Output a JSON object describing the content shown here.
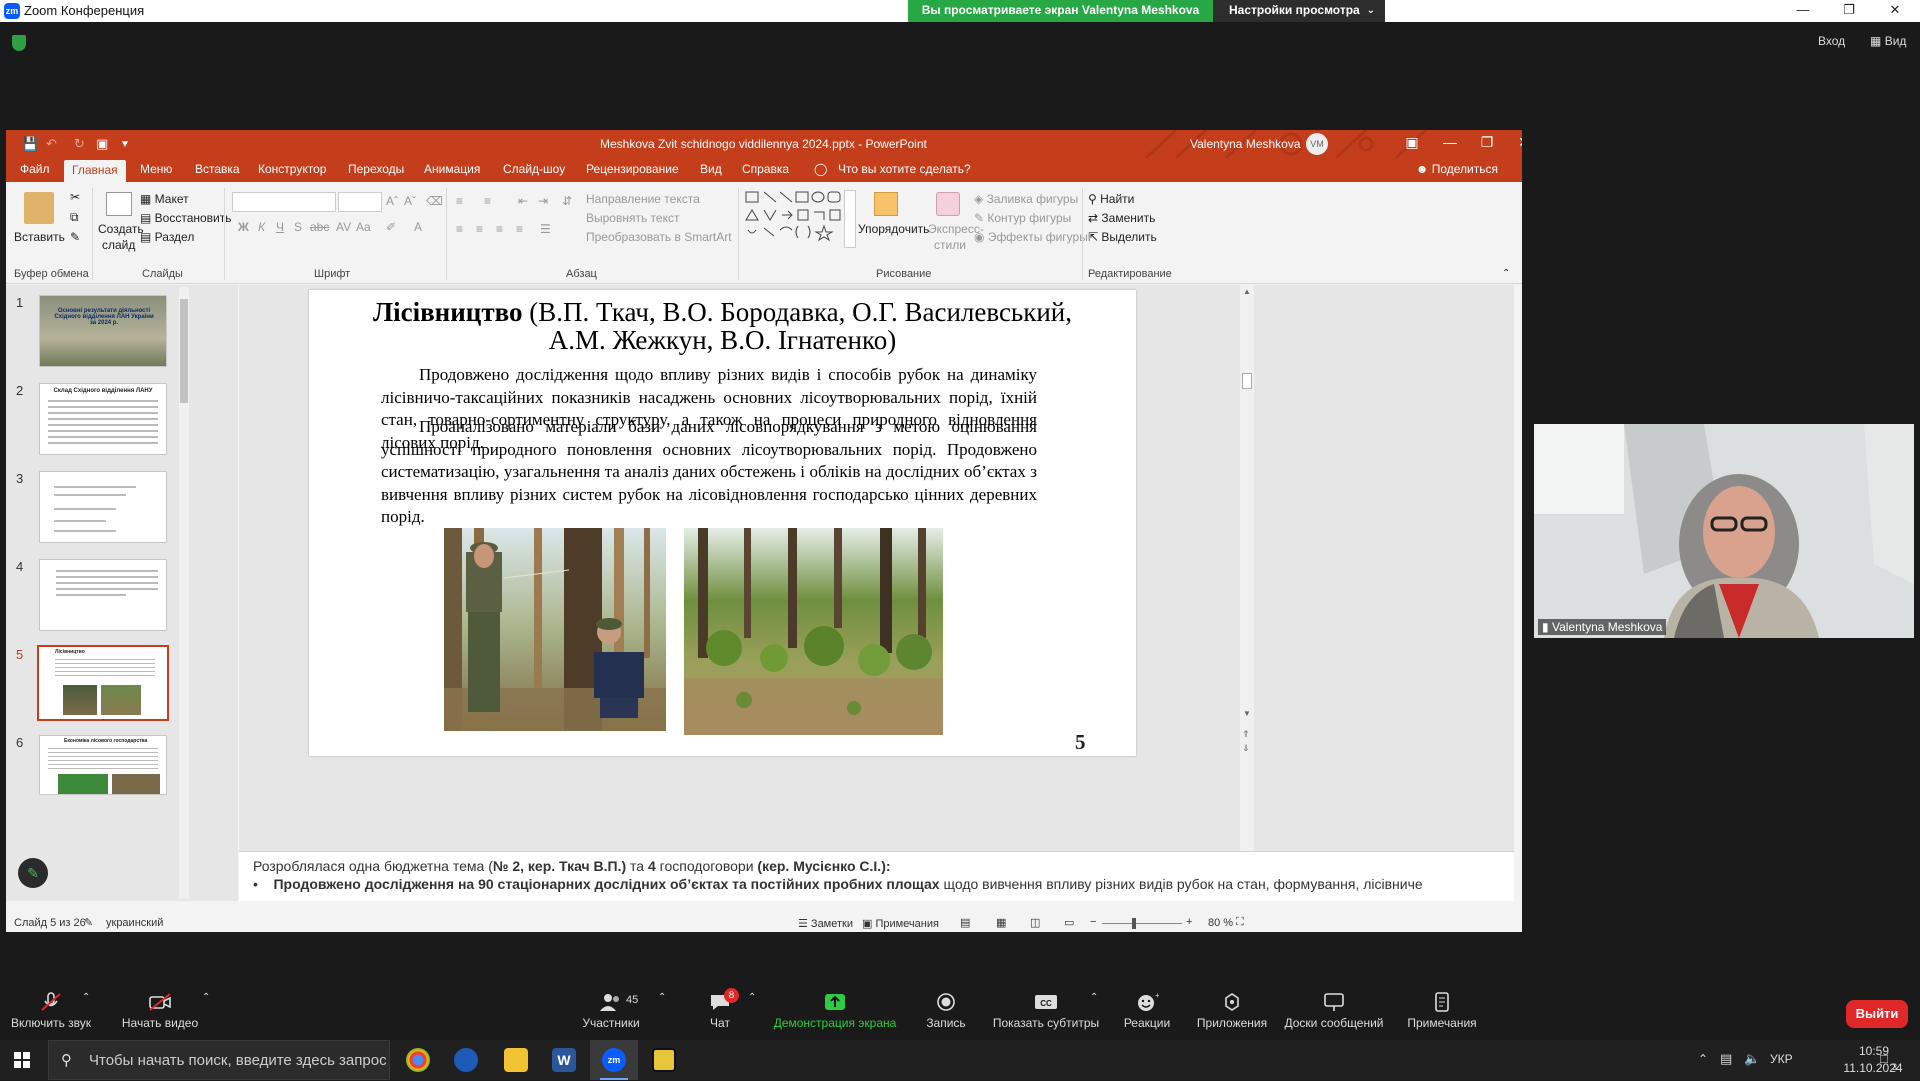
{
  "zoom": {
    "window_title": "Zoom Конференция",
    "viewing_banner": "Вы просматриваете экран Valentynа Meshkova",
    "view_options": "Настройки просмотра",
    "top_right": {
      "exit_fullscreen": "Вход",
      "view": "Вид"
    },
    "toolbar": {
      "unmute": "Включить звук",
      "start_video": "Начать видео",
      "participants": "Участники",
      "participants_count": "45",
      "chat": "Чат",
      "chat_badge": "8",
      "share_screen": "Демонстрация экрана",
      "record": "Запись",
      "captions": "Показать субтитры",
      "reactions": "Реакции",
      "apps": "Приложения",
      "whiteboards": "Доски сообщений",
      "notes": "Примечания",
      "leave": "Выйти"
    },
    "participant_name": "Valentyna Meshkova"
  },
  "ppt": {
    "file_title": "Meshkova Zvit schidnogo viddilennya 2024.pptx  -  PowerPoint",
    "user": "Valentyna Meshkova",
    "user_initials": "VM",
    "tabs": [
      "Файл",
      "Главная",
      "Меню",
      "Вставка",
      "Конструктор",
      "Переходы",
      "Анимация",
      "Слайд-шоу",
      "Рецензирование",
      "Вид",
      "Справка"
    ],
    "tell_me": "Что вы хотите сделать?",
    "share": "Поделиться",
    "ribbon": {
      "paste": "Вставить",
      "new_slide_1": "Создать",
      "new_slide_2": "слайд",
      "layout": "Макет",
      "reset": "Восстановить",
      "section": "Раздел",
      "text_direction": "Направление текста",
      "align_text": "Выровнять текст",
      "smartart": "Преобразовать в SmartArt",
      "arrange": "Упорядочить",
      "quick_styles_1": "Экспресс-",
      "quick_styles_2": "стили",
      "fill": "Заливка фигуры",
      "outline": "Контур фигуры",
      "effects": "Эффекты фигуры",
      "find": "Найти",
      "replace": "Заменить",
      "select": "Выделить",
      "groups": {
        "clipboard": "Буфер обмена",
        "slides": "Слайды",
        "font": "Шрифт",
        "paragraph": "Абзац",
        "drawing": "Рисование",
        "editing": "Редактирование"
      }
    },
    "thumbnails": [
      {
        "num": "1",
        "title": "Основні результати діяльності Східного відділення ЛАН України за 2024 р."
      },
      {
        "num": "2",
        "title": "Склад Східного відділення ЛАНУ"
      },
      {
        "num": "3",
        "title": ""
      },
      {
        "num": "4",
        "title": ""
      },
      {
        "num": "5",
        "title": "Лісівництво"
      },
      {
        "num": "6",
        "title": "Економіка лісового господарства"
      }
    ],
    "slide": {
      "title_bold": "Лісівництво",
      "title_rest": " (В.П. Ткач, В.О. Бородавка, О.Г. Василевський, А.М. Жежкун, В.О. Ігнатенко)",
      "para1": "Продовжено дослідження щодо впливу різних видів і способів рубок на динаміку лісівничо-таксаційних показників насаджень основних лісоутворювальних порід, їхній стан, товарно-сортиментну структуру, а також на процеси природного відновлення лісових порід.",
      "para2": "Проаналізовано матеріали бази даних лісовпорядкування з метою оцінювання успішності природного поновлення основних лісоутворювальних порід. Продовжено систематизацію, узагальнення та аналіз даних обстежень і обліків на дослідних об’єктах з вивчення впливу різних систем рубок на лісовідновлення господарсько цінних деревних порід.",
      "number": "5"
    },
    "notes_line1_a": "Розроблялася одна бюджетна тема (",
    "notes_line1_b": "№ 2, кер. Ткач В.П.)",
    "notes_line1_c": " та ",
    "notes_line1_d": "4",
    "notes_line1_e": " господоговори ",
    "notes_line1_f": "(кер. Мусієнко С.І.):",
    "notes_line2_bold": "Продовжено дослідження на 90 стаціонарних дослідних об’єктах та постійних пробних площах",
    "notes_line2_rest": " щодо вивчення впливу різних видів рубок на стан, формування, лісівниче",
    "status": {
      "slide_of": "Слайд 5 из 26",
      "language": "украинский",
      "notes": "Заметки",
      "comments": "Примечания",
      "zoom": "80 %"
    }
  },
  "taskbar": {
    "search_placeholder": "Чтобы начать поиск, введите здесь запрос",
    "language": "УКР",
    "time": "10:59",
    "date": "11.10.2024",
    "notif_count": "3"
  }
}
